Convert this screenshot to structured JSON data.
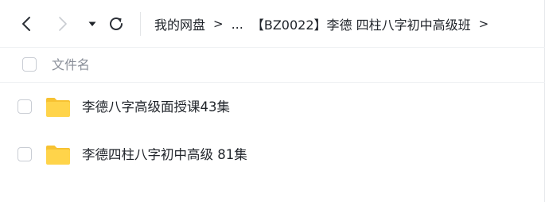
{
  "toolbar": {
    "icons": {
      "back": "chevron-left-icon",
      "forward": "chevron-right-icon",
      "dropdown": "caret-down-icon",
      "refresh": "refresh-icon"
    },
    "breadcrumb": {
      "root": "我的网盘",
      "separator": ">",
      "ellipsis": "...",
      "current": "【BZ0022】李德 四柱八字初中高级班",
      "trailing_separator": ">"
    }
  },
  "list": {
    "header_label": "文件名",
    "items": [
      {
        "name": "李德八字高级面授课43集",
        "icon": "folder-icon"
      },
      {
        "name": "李德四柱八字初中高级 81集",
        "icon": "folder-icon"
      }
    ]
  },
  "colors": {
    "text": "#1f2329",
    "muted_text": "#8a8f99",
    "folder": "#ffd44a",
    "folder_back": "#f7c232",
    "border": "#eef0f3"
  }
}
